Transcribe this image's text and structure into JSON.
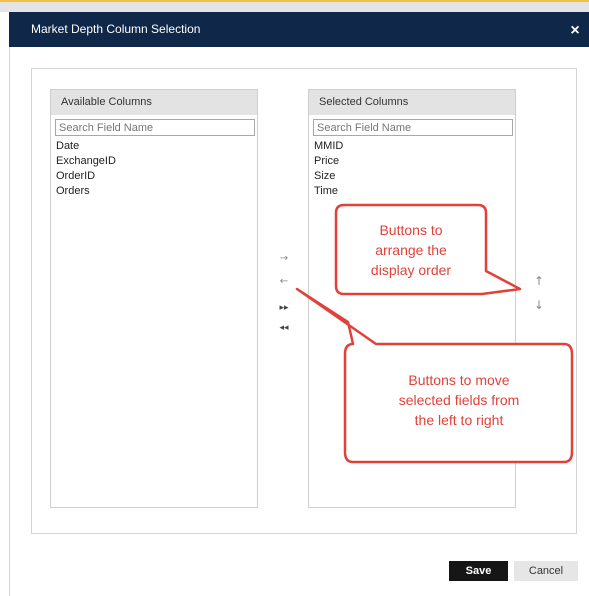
{
  "dialog": {
    "title": "Market Depth Column Selection",
    "close_label": "×"
  },
  "available_columns": {
    "header": "Available Columns",
    "search_placeholder": "Search Field Name",
    "items": [
      "Date",
      "ExchangeID",
      "OrderID",
      "Orders"
    ]
  },
  "selected_columns": {
    "header": "Selected Columns",
    "search_placeholder": "Search Field Name",
    "items": [
      "MMID",
      "Price",
      "Size",
      "Time"
    ]
  },
  "transfer_buttons": {
    "move_right": "→",
    "move_left": "←",
    "move_all_right": "▸▸",
    "move_all_left": "◂◂"
  },
  "order_buttons": {
    "move_up": "↑",
    "move_down": "↓"
  },
  "callouts": {
    "order": [
      "Buttons to",
      "arrange the",
      "display order"
    ],
    "transfer": [
      "Buttons to move",
      "selected fields from",
      "the left to right"
    ],
    "color": "#e0423a"
  },
  "footer": {
    "save_label": "Save",
    "cancel_label": "Cancel"
  }
}
